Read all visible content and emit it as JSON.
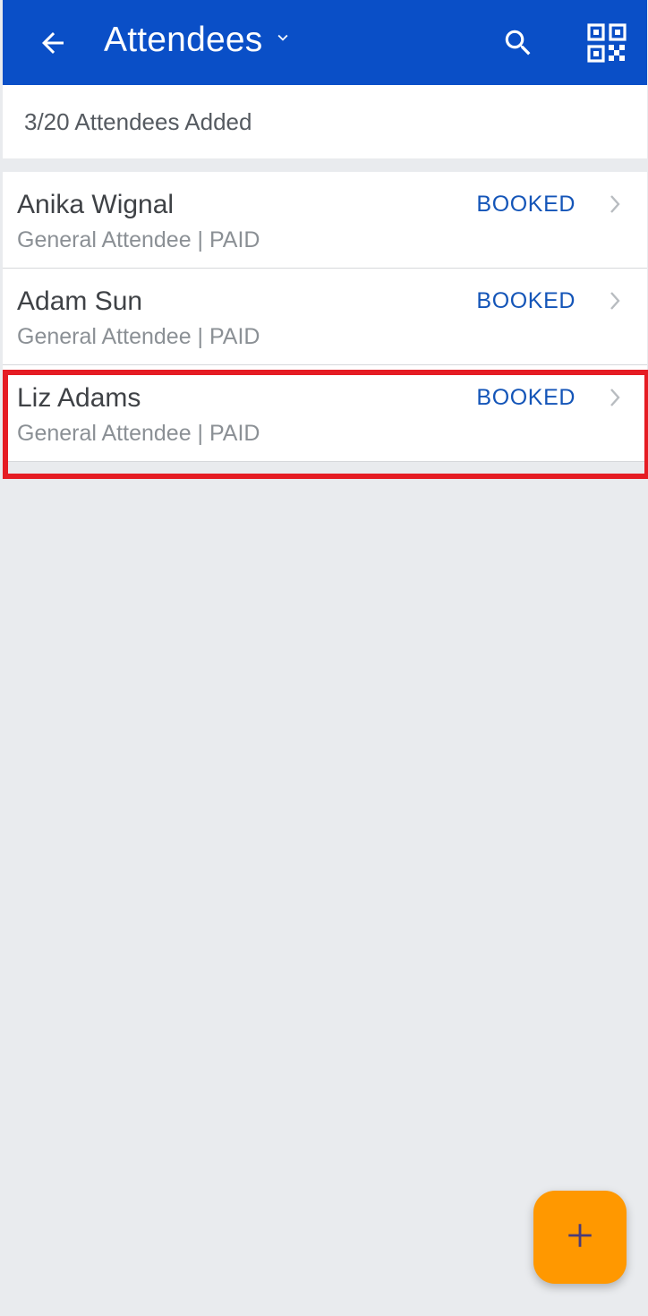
{
  "header": {
    "title": "Attendees",
    "back_icon": "arrow-left-icon",
    "caret_icon": "chevron-down-icon",
    "search_icon": "search-icon",
    "qr_icon": "qr-code-icon",
    "background_color": "#0a4fc7"
  },
  "summary": {
    "text": "3/20 Attendees Added"
  },
  "attendees": [
    {
      "name": "Anika Wignal",
      "details": "General Attendee | PAID",
      "status": "BOOKED"
    },
    {
      "name": "Adam Sun",
      "details": "General Attendee | PAID",
      "status": "BOOKED"
    },
    {
      "name": "Liz Adams",
      "details": "General Attendee | PAID",
      "status": "BOOKED"
    }
  ],
  "highlighted_row": 2,
  "colors": {
    "status": "#1455b8",
    "highlight": "#e51c23",
    "fab": "#ff9800",
    "fab_icon": "#4a3b7a"
  },
  "fab": {
    "icon": "plus-icon"
  }
}
